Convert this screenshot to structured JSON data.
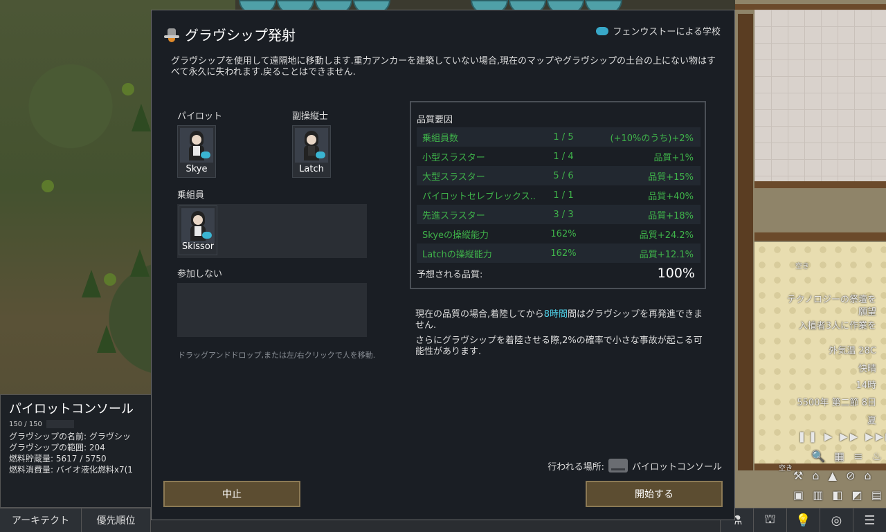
{
  "dialog": {
    "title": "グラヴシップ発射",
    "ideology": "フェンウストーによる学校",
    "description": "グラヴシップを使用して遠隔地に移動します.重力アンカーを建築していない場合,現在のマップやグラヴシップの土台の上にない物はすべて永久に失われます.戻ることはできません.",
    "pilot_label": "パイロット",
    "copilot_label": "副操縦士",
    "crew_label": "乗組員",
    "absent_label": "参加しない",
    "pilot": "Skye",
    "copilot": "Latch",
    "crew": [
      "Skissor"
    ],
    "drag_hint": "ドラッグアンドドロップ,または左/右クリックで人を移動.",
    "quality": {
      "title": "品質要因",
      "rows": [
        {
          "name": "乗組員数",
          "count": "1 / 5",
          "effect": "(+10%のうち)+2%"
        },
        {
          "name": "小型スラスター",
          "count": "1 / 4",
          "effect": "品質+1%"
        },
        {
          "name": "大型スラスター",
          "count": "5 / 6",
          "effect": "品質+15%"
        },
        {
          "name": "パイロットセレブレックス...",
          "count": "1 / 1",
          "effect": "品質+40%"
        },
        {
          "name": "先進スラスター",
          "count": "3 / 3",
          "effect": "品質+18%"
        },
        {
          "name": "Skyeの操縦能力",
          "count": "162%",
          "effect": "品質+24.2%"
        },
        {
          "name": "Latchの操縦能力",
          "count": "162%",
          "effect": "品質+12.1%"
        }
      ],
      "expected_label": "予想される品質:",
      "expected_value": "100%"
    },
    "note1_prefix": "現在の品質の場合,着陸してから",
    "note1_highlight": "8時間",
    "note1_suffix": "間はグラヴシップを再発進できません.",
    "note2": "さらにグラヴシップを着陸させる際,2%の確率で小さな事故が起こる可能性があります.",
    "location_label": "行われる場所:",
    "location_value": "パイロットコンソール",
    "cancel": "中止",
    "start": "開始する"
  },
  "inspect": {
    "title": "パイロットコンソール",
    "hp": "150 / 150",
    "lines": [
      "グラヴシップの名前: グラヴシッ",
      "グラヴシップの範囲: 204",
      "燃料貯蔵量: 5617 / 5750",
      "燃料消費量: バイオ液化燃料x7(1"
    ]
  },
  "bottombar": {
    "tabs": [
      "アーキテクト",
      "優先順位"
    ]
  },
  "world": {
    "alert1": "テクノロジーの祭壇を",
    "alert1b": "願望",
    "alert2": "入植者3人に作業を",
    "temp": "外気温 28C",
    "weather": "快晴",
    "time": "14時",
    "date": "5500年 第二節 8日",
    "season": "夏",
    "bed1": "空き",
    "bed2": "空き"
  },
  "colors": {
    "accent_green": "#3fb34a",
    "highlight_cyan": "#4fd0e8",
    "button_brown": "#5c4d31"
  }
}
